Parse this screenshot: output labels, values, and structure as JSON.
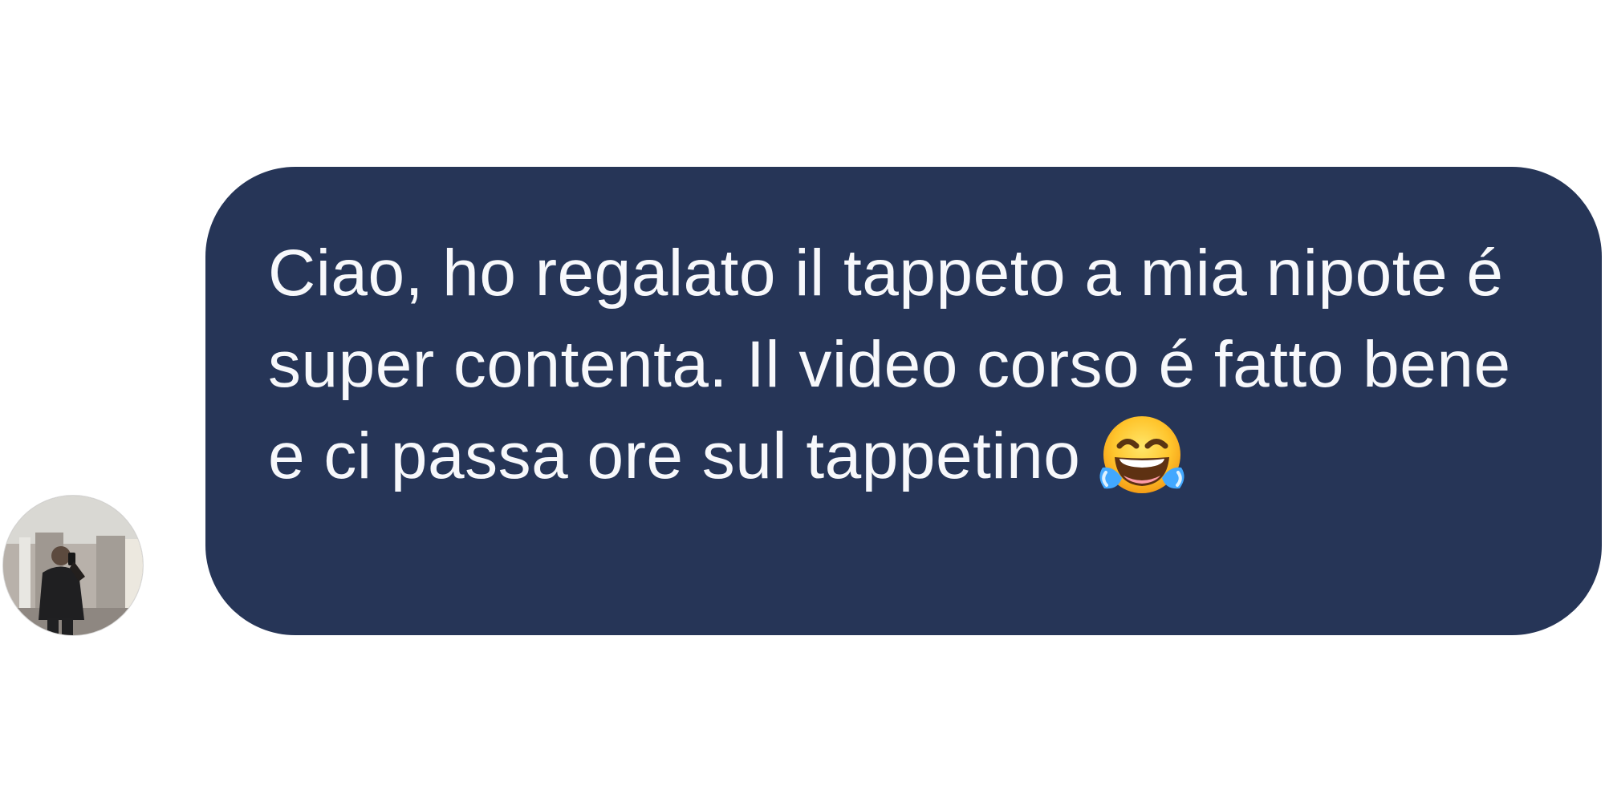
{
  "message": {
    "sender_avatar_icon": "profile-photo-icon",
    "text": "Ciao, ho regalato il tappeto a mia nipote é super contenta. Il video corso é fatto bene e ci passa ore sul tappetino",
    "emoji_icon": "face-with-tears-of-joy-icon",
    "bubble_color": "#263557",
    "text_color": "#f7f8fb"
  }
}
